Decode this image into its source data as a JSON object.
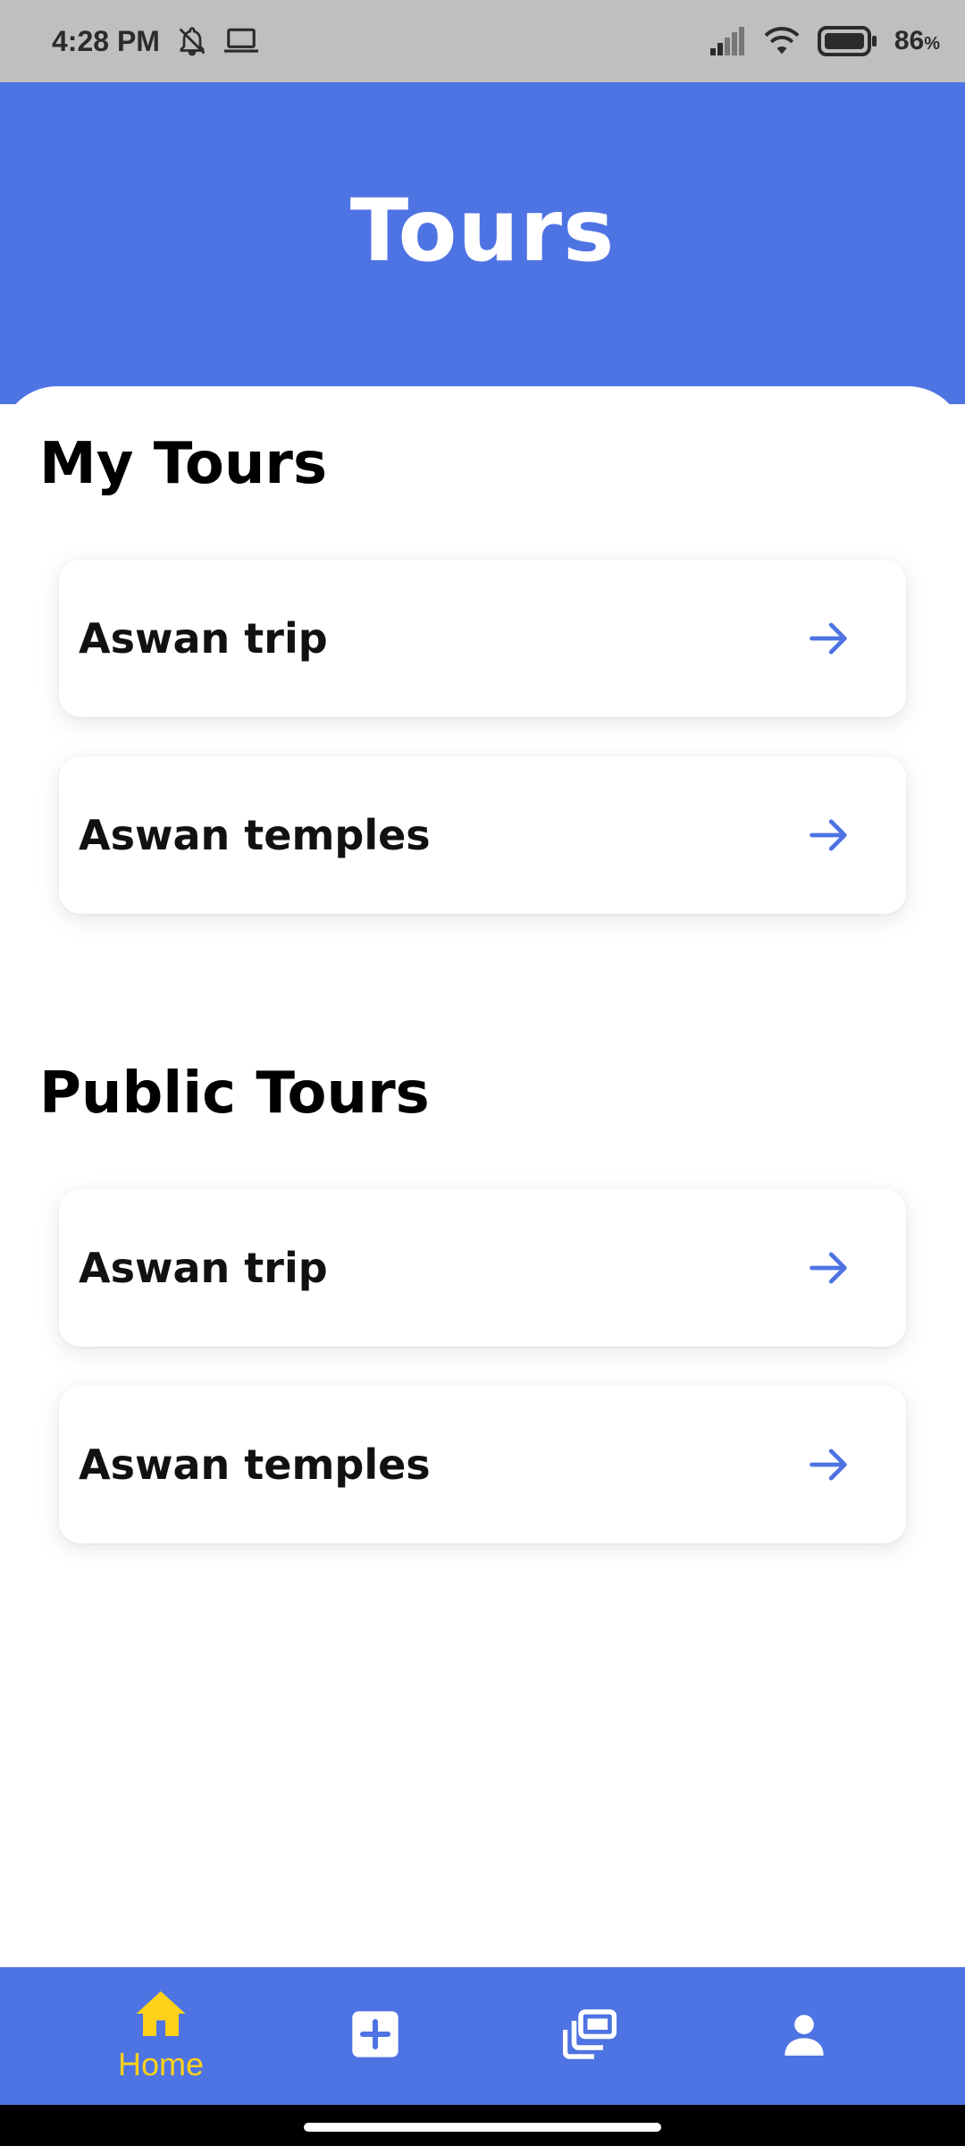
{
  "status_bar": {
    "time": "4:28 PM",
    "battery": "86",
    "battery_unit": "%",
    "icons": [
      "notifications-off-icon",
      "laptop-icon",
      "signal-icon",
      "wifi-icon",
      "battery-icon"
    ]
  },
  "header": {
    "title": "Tours"
  },
  "my_tours": {
    "title": "My Tours",
    "items": [
      {
        "label": "Aswan trip"
      },
      {
        "label": "Aswan temples"
      }
    ]
  },
  "public_tours": {
    "title": "Public Tours",
    "items": [
      {
        "label": "Aswan trip"
      },
      {
        "label": "Aswan temples"
      }
    ]
  },
  "bottom_nav": {
    "items": [
      {
        "label": "Home",
        "icon": "home-icon",
        "active": true
      },
      {
        "label": "",
        "icon": "add-box-icon",
        "active": false
      },
      {
        "label": "",
        "icon": "collections-icon",
        "active": false
      },
      {
        "label": "",
        "icon": "person-icon",
        "active": false
      }
    ]
  },
  "colors": {
    "primary": "#4e73e3",
    "active_nav": "#ffd21a",
    "arrow": "#4e73e3",
    "status_bar": "#bfbfbf"
  }
}
